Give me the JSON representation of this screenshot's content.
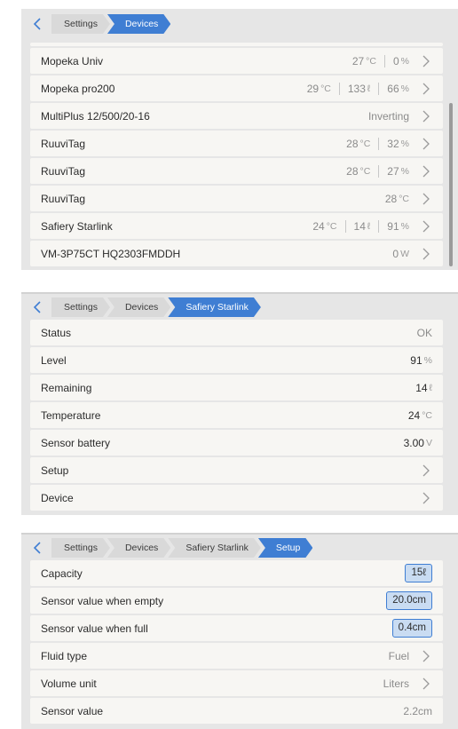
{
  "panel1": {
    "breadcrumb": [
      "Settings",
      "Devices"
    ],
    "rows": [
      {
        "name": "Mopeka Univ",
        "vals": [
          {
            "v": "27",
            "u": "°C"
          },
          {
            "v": "0",
            "u": "%"
          }
        ]
      },
      {
        "name": "Mopeka pro200",
        "vals": [
          {
            "v": "29",
            "u": "°C"
          },
          {
            "v": "133",
            "u": "ℓ"
          },
          {
            "v": "66",
            "u": "%"
          }
        ]
      },
      {
        "name": "MultiPlus 12/500/20-16",
        "vals": [
          {
            "v": "Inverting",
            "u": ""
          }
        ]
      },
      {
        "name": "RuuviTag",
        "vals": [
          {
            "v": "28",
            "u": "°C"
          },
          {
            "v": "32",
            "u": "%"
          }
        ]
      },
      {
        "name": "RuuviTag",
        "vals": [
          {
            "v": "28",
            "u": "°C"
          },
          {
            "v": "27",
            "u": "%"
          }
        ]
      },
      {
        "name": "RuuviTag",
        "vals": [
          {
            "v": "28",
            "u": "°C"
          }
        ]
      },
      {
        "name": "Safiery Starlink",
        "vals": [
          {
            "v": "24",
            "u": "°C"
          },
          {
            "v": "14",
            "u": "ℓ"
          },
          {
            "v": "91",
            "u": "%"
          }
        ]
      },
      {
        "name": "VM-3P75CT HQ2303FMDDH",
        "vals": [
          {
            "v": "0",
            "u": "W"
          }
        ]
      }
    ]
  },
  "panel2": {
    "breadcrumb": [
      "Settings",
      "Devices",
      "Safiery Starlink"
    ],
    "rows": [
      {
        "name": "Status",
        "value": "OK",
        "unit": ""
      },
      {
        "name": "Level",
        "value": "91",
        "unit": "%"
      },
      {
        "name": "Remaining",
        "value": "14",
        "unit": "ℓ"
      },
      {
        "name": "Temperature",
        "value": "24",
        "unit": "°C"
      },
      {
        "name": "Sensor battery",
        "value": "3.00",
        "unit": "V"
      },
      {
        "name": "Setup"
      },
      {
        "name": "Device"
      }
    ]
  },
  "panel3": {
    "breadcrumb": [
      "Settings",
      "Devices",
      "Safiery Starlink",
      "Setup"
    ],
    "rows": [
      {
        "name": "Capacity",
        "value": "15ℓ"
      },
      {
        "name": "Sensor value when empty",
        "value": "20.0cm"
      },
      {
        "name": "Sensor value when full",
        "value": "0.4cm"
      },
      {
        "name": "Fluid type",
        "value": "Fuel"
      },
      {
        "name": "Volume unit",
        "value": "Liters"
      },
      {
        "name": "Sensor value",
        "value": "2.2cm"
      }
    ]
  },
  "colors": {
    "accent": "#3f7ed3",
    "row_bg": "#f7f6f3",
    "panel_bg": "#e6e6e6"
  }
}
